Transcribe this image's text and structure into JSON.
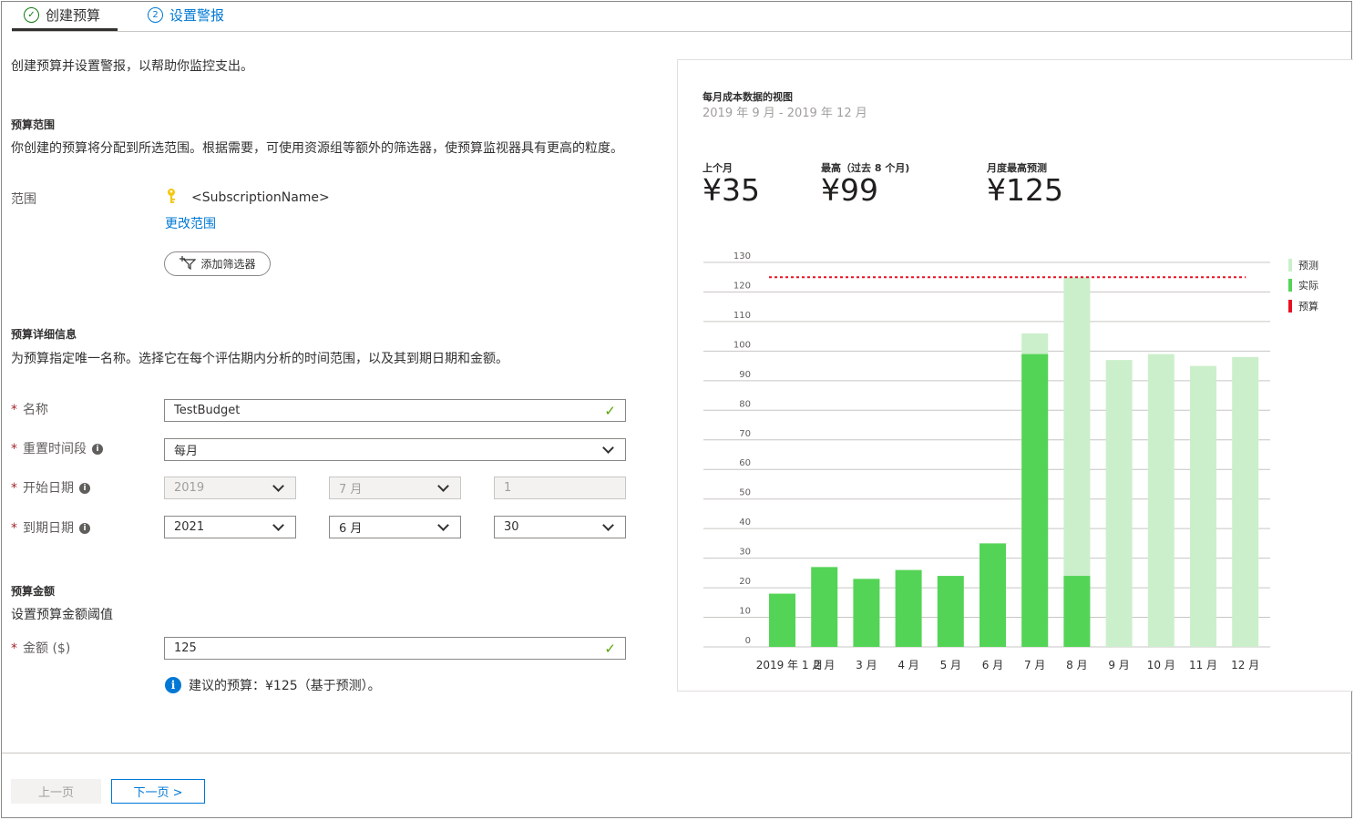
{
  "wizard": {
    "steps": [
      {
        "label": "创建预算",
        "status_glyph": "✓"
      },
      {
        "label": "设置警报",
        "number": "2"
      }
    ]
  },
  "intro": "创建预算并设置警报，以帮助你监控支出。",
  "scope_section": {
    "title": "预算范围",
    "description": "你创建的预算将分配到所选范围。根据需要，可使用资源组等额外的筛选器，使预算监视器具有更高的粒度。",
    "scope_label": "范围",
    "scope_value": "<SubscriptionName>",
    "change_scope_link": "更改范围",
    "add_filter_button": "添加筛选器"
  },
  "details_section": {
    "title": "预算详细信息",
    "description": "为预算指定唯一名称。选择它在每个评估期内分析的时间范围，以及其到期日期和金额。",
    "name_label": "名称",
    "name_value": "TestBudget",
    "reset_label": "重置时间段",
    "reset_value": "每月",
    "start_label": "开始日期",
    "start_year": "2019",
    "start_month": "7 月",
    "start_day": "1",
    "end_label": "到期日期",
    "end_year": "2021",
    "end_month": "6 月",
    "end_day": "30",
    "required_mark": "*",
    "info_glyph": "i"
  },
  "amount_section": {
    "title": "预算金额",
    "description": "设置预算金额阈值",
    "amount_label": "金额 ($)",
    "amount_value": "125",
    "suggestion": "建议的预算：¥125（基于预测）。",
    "info_glyph": "i"
  },
  "footer": {
    "prev_button": "上一页",
    "next_button": "下一页 >"
  },
  "panel": {
    "title": "每月成本数据的视图",
    "date_range": "2019 年 9 月 - 2019 年 12 月",
    "kpis": [
      {
        "label": "上个月",
        "value": "¥35"
      },
      {
        "label": "最高（过去 8 个月)",
        "value": "¥99"
      },
      {
        "label": "月度最高预测",
        "value": "¥125"
      }
    ]
  },
  "colors": {
    "accent": "#0078d4",
    "actual": "#54d456",
    "forecast": "#cbefcb",
    "budget": "#e81123",
    "valid_check": "#57a300",
    "required": "#a4262c"
  },
  "chart_data": {
    "type": "bar",
    "categories": [
      "2019 年 1 月",
      "2 月",
      "3 月",
      "4 月",
      "5 月",
      "6 月",
      "7 月",
      "8 月",
      "9 月",
      "10 月",
      "11 月",
      "12 月"
    ],
    "series": [
      {
        "name": "实际",
        "values": [
          18,
          27,
          23,
          26,
          24,
          35,
          99,
          24,
          null,
          null,
          null,
          null
        ]
      },
      {
        "name": "预测",
        "values": [
          null,
          null,
          null,
          null,
          null,
          null,
          106,
          125,
          97,
          99,
          95,
          98
        ]
      }
    ],
    "budget_line": {
      "name": "预算",
      "value": 125
    },
    "legend": [
      "预测",
      "实际",
      "预算"
    ],
    "legend_position": "right",
    "yticks": [
      0,
      10,
      20,
      30,
      40,
      50,
      60,
      70,
      80,
      90,
      100,
      110,
      120,
      130
    ],
    "ylim": [
      0,
      130
    ],
    "grid": true
  }
}
